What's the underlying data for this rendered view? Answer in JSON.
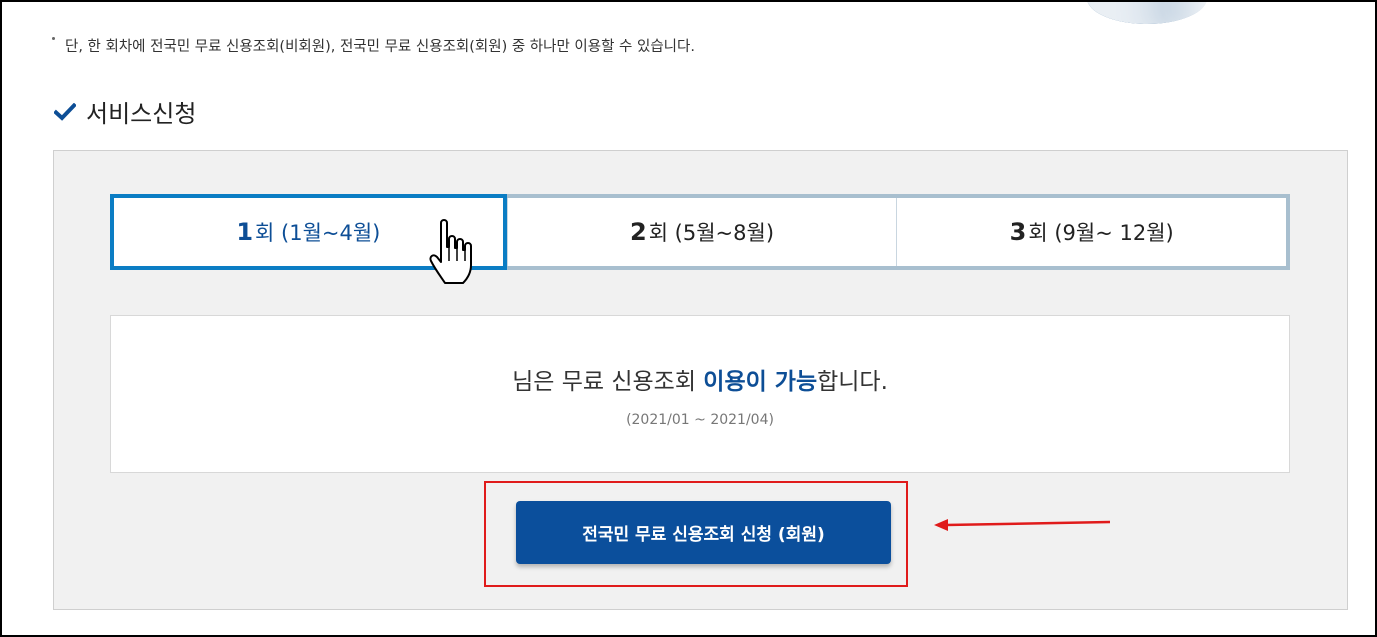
{
  "notice": {
    "text": "단, 한 회차에 전국민 무료 신용조회(비회원), 전국민 무료 신용조회(회원) 중 하나만 이용할 수 있습니다."
  },
  "section": {
    "title": "서비스신청",
    "icon": "check-icon"
  },
  "tabs": [
    {
      "num": "1",
      "suffix": "회 (1월~4월)",
      "active": true
    },
    {
      "num": "2",
      "suffix": "회 (5월~8월)",
      "active": false
    },
    {
      "num": "3",
      "suffix": "회 (9월~ 12월)",
      "active": false
    }
  ],
  "result": {
    "prefix": "님은 무료 신용조회 ",
    "highlight": "이용이 가능",
    "suffix": "합니다.",
    "period": "(2021/01 ~ 2021/04)"
  },
  "apply_button": {
    "label": "전국민 무료 신용조회 신청 (회원)"
  },
  "colors": {
    "accent": "#0d4e96",
    "active_tab_border": "#0b7dc4",
    "tab_border": "#a8bfcf",
    "button": "#0b4f9c",
    "annotation_red": "#e01b1b",
    "panel_bg": "#f1f1f1"
  }
}
